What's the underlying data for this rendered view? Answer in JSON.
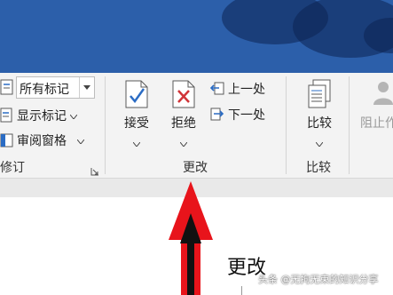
{
  "ribbon": {
    "tracking_group": {
      "markup_combo_value": "所有标记",
      "show_markup_label": "显示标记",
      "reviewing_pane_label": "审阅窗格",
      "group_label": "修订"
    },
    "changes_group": {
      "accept_label": "接受",
      "reject_label": "拒绝",
      "previous_label": "上一处",
      "next_label": "下一处",
      "group_label": "更改"
    },
    "compare_group": {
      "compare_label": "比较",
      "group_label": "比较"
    },
    "protect_group": {
      "block_authors_label": "阻止作"
    }
  },
  "document": {
    "heading": "更改"
  },
  "watermark": {
    "text": "头条 @无拘无束的知识分享"
  },
  "colors": {
    "title_bar": "#2c5faa",
    "ribbon_bg": "#f3f3f3",
    "annotation_arrow": "#e8141b",
    "accept_check": "#2b6cc4",
    "reject_x": "#d13438"
  }
}
